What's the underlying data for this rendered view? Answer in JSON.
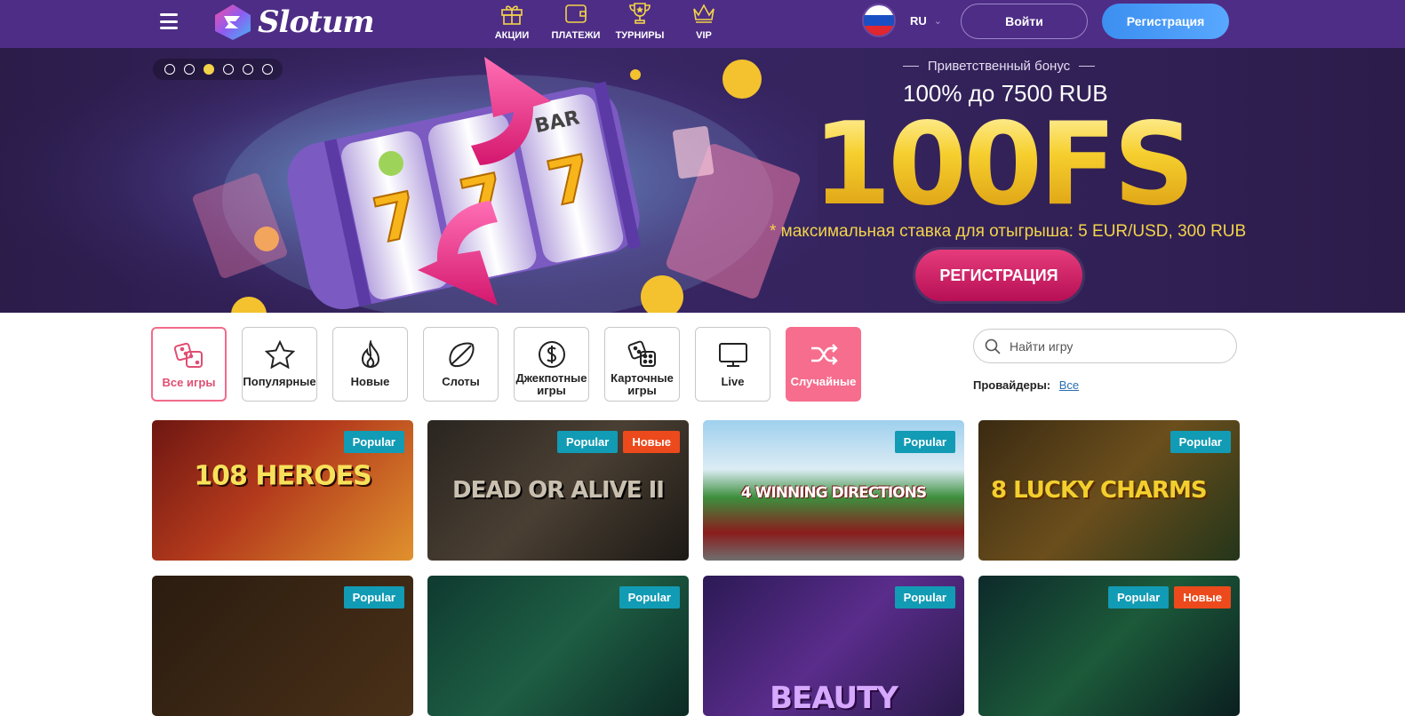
{
  "header": {
    "logo_text": "Slotum",
    "nav": [
      {
        "label": "АКЦИИ",
        "icon": "gift-icon"
      },
      {
        "label": "ПЛАТЕЖИ",
        "icon": "wallet-icon"
      },
      {
        "label": "ТУРНИРЫ",
        "icon": "trophy-icon"
      },
      {
        "label": "VIP",
        "icon": "crown-icon"
      }
    ],
    "language": "RU",
    "login_label": "Войти",
    "register_label": "Регистрация"
  },
  "banner": {
    "slides_count": 6,
    "active_slide": 3,
    "subtitle": "Приветственный бонус",
    "amount": "100% до 7500 RUB",
    "headline": "100FS",
    "note": "* максимальная ставка для отыгрыша: 5 EUR/USD, 300 RUB",
    "cta_label": "РЕГИСТРАЦИЯ"
  },
  "categories": [
    {
      "label": "Все игры",
      "icon": "dice-icon",
      "state": "selected"
    },
    {
      "label": "Популярные",
      "icon": "star-icon"
    },
    {
      "label": "Новые",
      "icon": "flame-icon"
    },
    {
      "label": "Слоты",
      "icon": "lemon-icon"
    },
    {
      "label": "Джекпотные игры",
      "icon": "dollar-coin-icon"
    },
    {
      "label": "Карточные игры",
      "icon": "card-dice-icon"
    },
    {
      "label": "Live",
      "icon": "monitor-icon"
    },
    {
      "label": "Случайные",
      "icon": "shuffle-icon",
      "state": "highlighted"
    }
  ],
  "search": {
    "placeholder": "Найти игру"
  },
  "providers": {
    "label": "Провайдеры:",
    "value": "Все"
  },
  "games": [
    {
      "title": "108 HEROES",
      "badges": [
        "Popular"
      ]
    },
    {
      "title": "DEAD OR ALIVE II",
      "badges": [
        "Popular",
        "Новые"
      ]
    },
    {
      "title": "4 WINNING DIRECTIONS",
      "badges": [
        "Popular"
      ]
    },
    {
      "title": "8 LUCKY CHARMS",
      "badges": [
        "Popular"
      ]
    },
    {
      "title": "",
      "badges": [
        "Popular"
      ]
    },
    {
      "title": "",
      "badges": [
        "Popular"
      ]
    },
    {
      "title": "BEAUTY",
      "badges": [
        "Popular"
      ]
    },
    {
      "title": "",
      "badges": [
        "Popular",
        "Новые"
      ]
    }
  ],
  "colors": {
    "header_bg": "#4e2d86",
    "accent_pink": "#f66d8d",
    "badge_popular": "#129bb4",
    "badge_new": "#ec4a1c",
    "gold": "#f3d34a"
  }
}
